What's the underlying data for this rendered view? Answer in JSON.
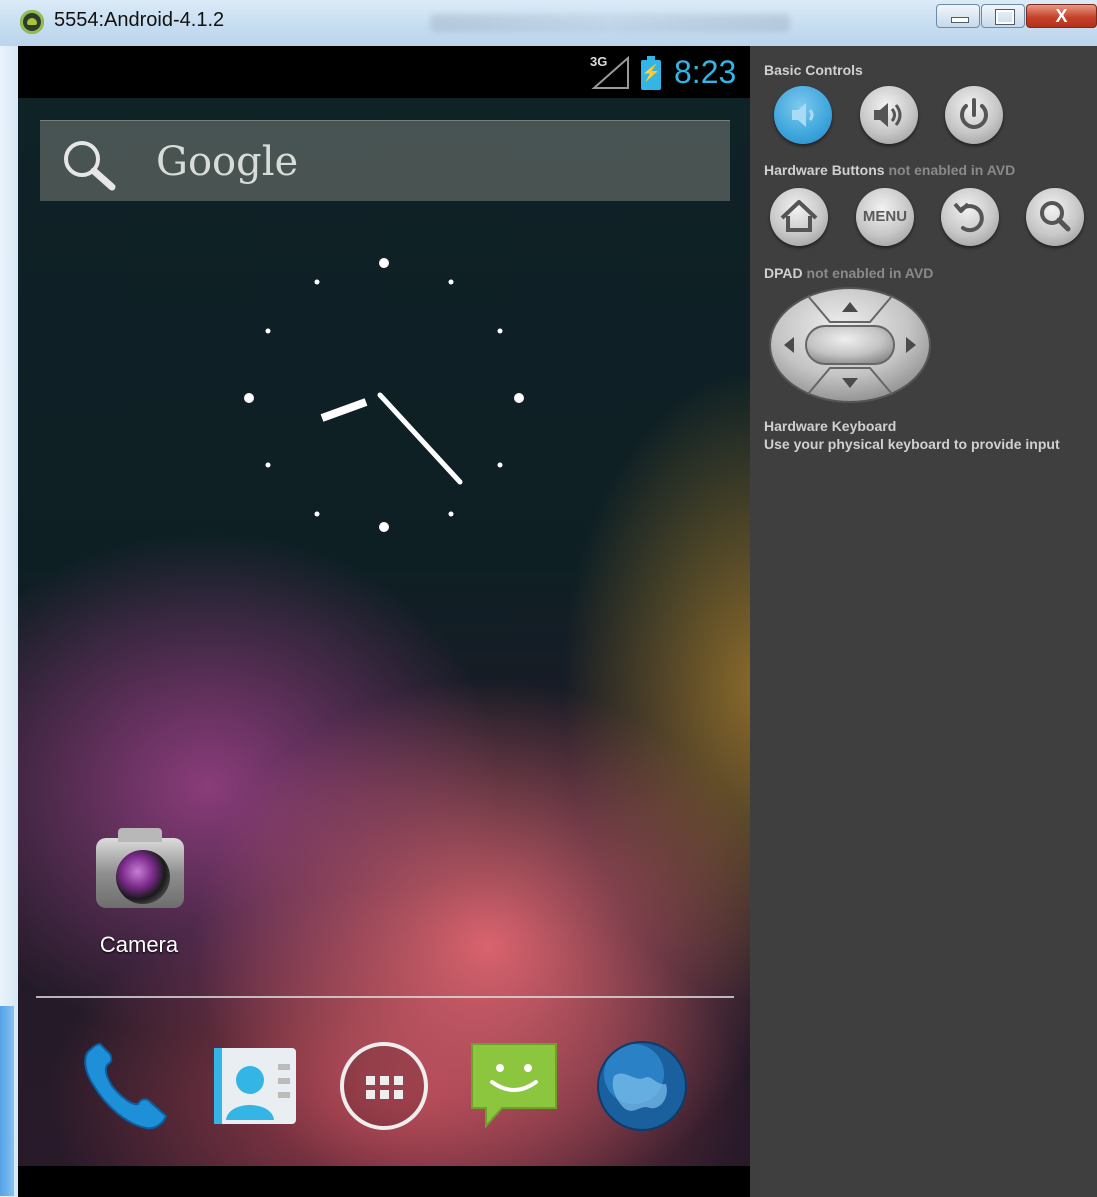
{
  "window": {
    "title": "5554:Android-4.1.2",
    "close_glyph": "X"
  },
  "statusbar": {
    "network": "3G",
    "time": "8:23",
    "battery_glyph": "⚡"
  },
  "search": {
    "label": "Google"
  },
  "home": {
    "app_label": "Camera"
  },
  "dock": {
    "icons": [
      "phone-icon",
      "contacts-icon",
      "all-apps-icon",
      "messaging-icon",
      "browser-icon"
    ]
  },
  "panel": {
    "basic_controls": "Basic Controls",
    "hardware_buttons": "Hardware Buttons",
    "hardware_buttons_note": "not enabled in AVD",
    "dpad": "DPAD",
    "dpad_note": "not enabled in AVD",
    "keyboard_title": "Hardware Keyboard",
    "keyboard_sub": "Use your physical keyboard to provide input",
    "menu_label": "MENU"
  },
  "colors": {
    "accent": "#33b5e5",
    "panel_bg": "#3f3f3f"
  }
}
